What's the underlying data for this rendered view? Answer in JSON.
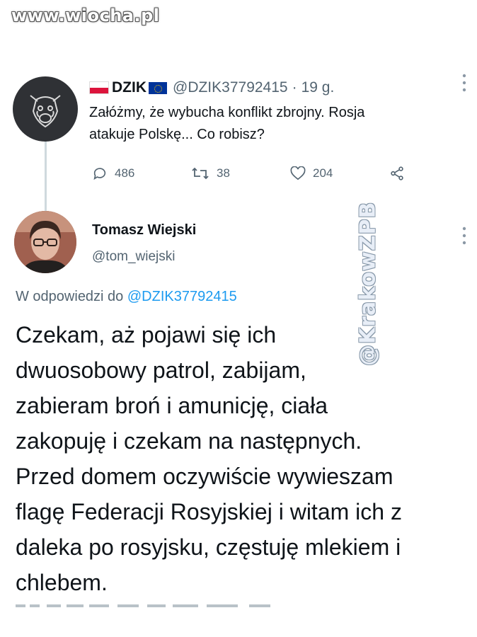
{
  "watermark": "www.wiocha.pl",
  "side_watermark": "@KrakowZPB",
  "tweet1": {
    "name": "DZIK",
    "handle": "@DZIK37792415",
    "separator": "·",
    "time": "19 g.",
    "text": "Załóżmy, że wybucha konflikt zbrojny. Rosja atakuje Polskę... Co robisz?",
    "replies": "486",
    "retweets": "38",
    "likes": "204",
    "more_icon": "more-vertical-icon"
  },
  "tweet2": {
    "name": "Tomasz Wiejski",
    "handle": "@tom_wiejski",
    "reply_prefix": "W odpowiedzi do",
    "reply_handle": "@DZIK37792415",
    "text": "Czekam, aż pojawi się ich\ndwuosobowy patrol, zabijam,\nzabieram broń i amunicję, ciała\nzakopuję i czekam na następnych.\nPrzed domem oczywiście wywieszam\nflagę Federacji Rosyjskiej i witam ich z\ndaleka po rosyjsku, częstuję mlekiem i\nchlebem."
  },
  "colors": {
    "text": "#0f1419",
    "secondary": "#536471",
    "link": "#1d9bf0"
  }
}
